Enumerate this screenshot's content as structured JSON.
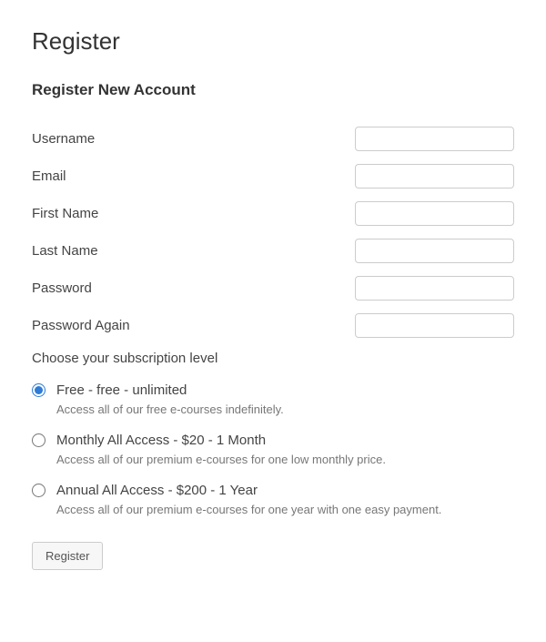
{
  "page": {
    "title": "Register",
    "sectionTitle": "Register New Account"
  },
  "fields": {
    "username": {
      "label": "Username",
      "value": ""
    },
    "email": {
      "label": "Email",
      "value": ""
    },
    "firstName": {
      "label": "First Name",
      "value": ""
    },
    "lastName": {
      "label": "Last Name",
      "value": ""
    },
    "password": {
      "label": "Password",
      "value": ""
    },
    "passwordAgain": {
      "label": "Password Again",
      "value": ""
    }
  },
  "subscription": {
    "prompt": "Choose your subscription level",
    "options": [
      {
        "label": "Free - free -  unlimited",
        "description": "Access all of our free e-courses indefinitely.",
        "selected": true
      },
      {
        "label": "Monthly All Access - $20 -  1 Month",
        "description": "Access all of our premium e-courses for one low monthly price.",
        "selected": false
      },
      {
        "label": "Annual All Access - $200 -  1 Year",
        "description": "Access all of our premium e-courses for one year with one easy payment.",
        "selected": false
      }
    ]
  },
  "actions": {
    "registerButton": "Register"
  }
}
